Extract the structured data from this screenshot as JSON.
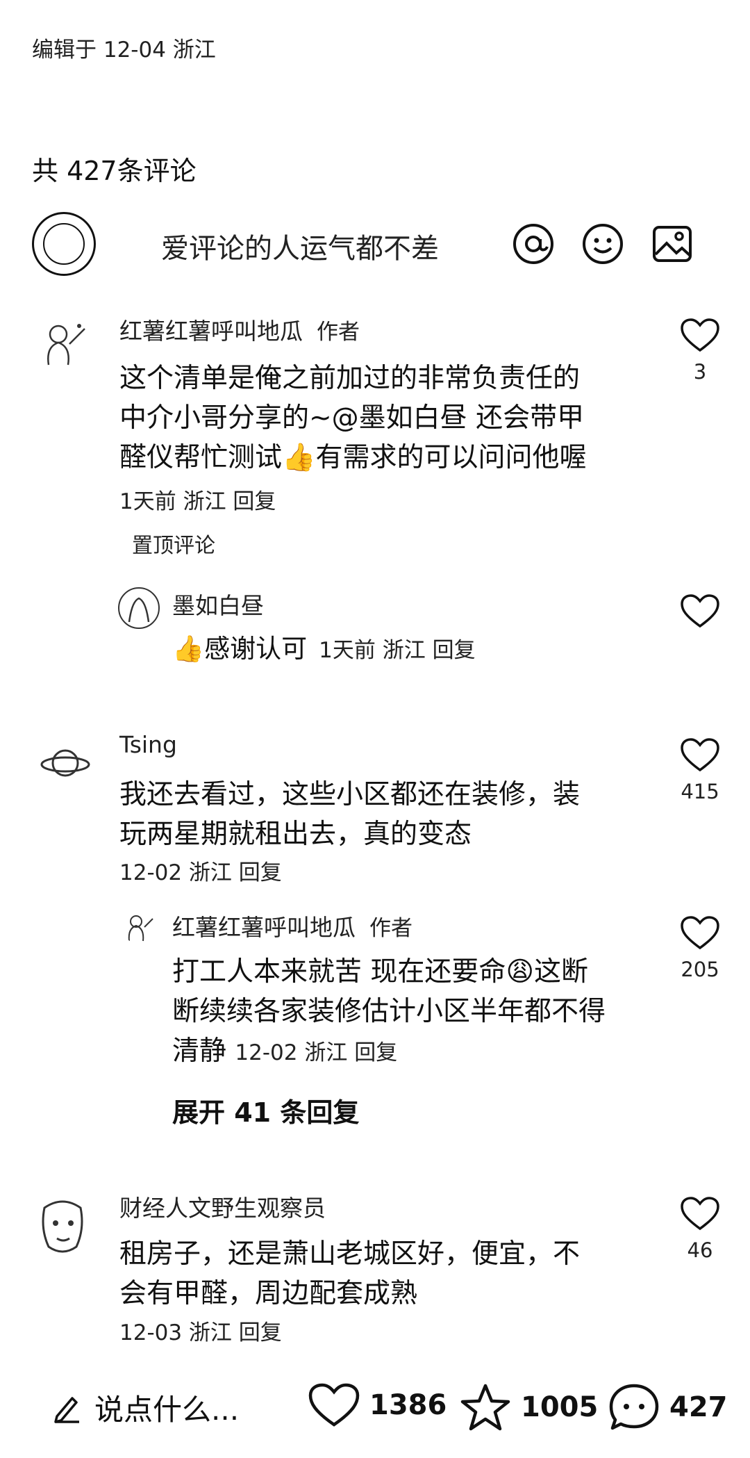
{
  "post": {
    "edited": "编辑于 12-04 浙江"
  },
  "comments_header": {
    "count_label": "共 427条评论"
  },
  "composer": {
    "placeholder": "爱评论的人运气都不差"
  },
  "comments": [
    {
      "name": "红薯红薯呼叫地瓜",
      "tag": "作者",
      "lines": [
        "这个清单是俺之前加过的非常负责任的",
        "中介小哥分享的~@墨如白昼  还会带甲",
        "醛仪帮忙测试👍有需求的可以问问他喔"
      ],
      "meta": "1天前  浙江 回复",
      "pinned": "置顶评论",
      "likes": "3",
      "reply": {
        "name": "墨如白昼",
        "line": "👍感谢认可",
        "meta": "1天前  浙江 回复"
      }
    },
    {
      "name": "Tsing",
      "lines": [
        "我还去看过，这些小区都还在装修，装",
        "玩两星期就租出去，真的变态"
      ],
      "meta": "12-02 浙江 回复",
      "likes": "415",
      "reply": {
        "name": "红薯红薯呼叫地瓜",
        "tag": "作者",
        "lines": [
          "打工人本来就苦 现在还要命😩这断",
          "断续续各家装修估计小区半年都不得",
          "清静"
        ],
        "meta": "12-02 浙江 回复",
        "likes": "205"
      },
      "expand": "展开 41 条回复"
    },
    {
      "name": "财经人文野生观察员",
      "lines": [
        "租房子，还是萧山老城区好，便宜，不",
        "会有甲醛，周边配套成熟"
      ],
      "meta": "12-03 浙江 回复",
      "likes": "46"
    }
  ],
  "bottom_bar": {
    "say": "说点什么...",
    "likes": "1386",
    "favorites": "1005",
    "comments": "427"
  }
}
